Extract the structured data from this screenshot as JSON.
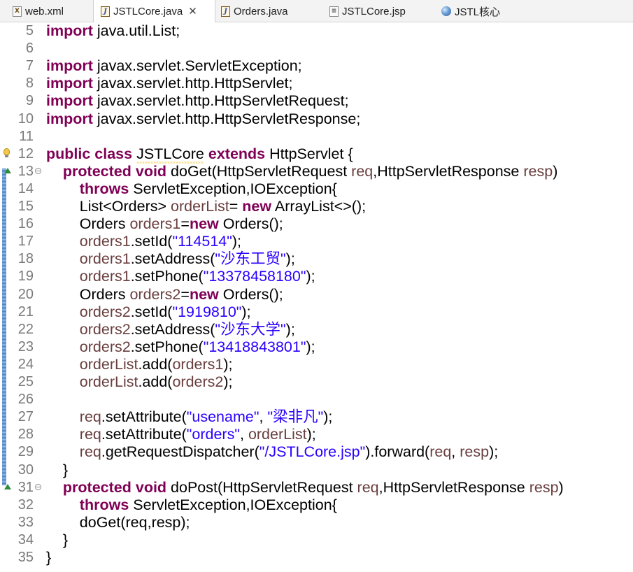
{
  "tabs": [
    {
      "label": "web.xml",
      "icon": "xml-file-icon",
      "icon_glyph": "X",
      "active": false
    },
    {
      "label": "JSTLCore.java",
      "icon": "java-file-icon",
      "icon_glyph": "J",
      "active": true,
      "close_glyph": "✕"
    },
    {
      "label": "Orders.java",
      "icon": "java-file-icon",
      "icon_glyph": "J",
      "active": false
    },
    {
      "label": "JSTLCore.jsp",
      "icon": "jsp-file-icon",
      "icon_glyph": "≡",
      "active": false
    },
    {
      "label": "JSTL核心",
      "icon": "browser-globe-icon",
      "active": false
    }
  ],
  "colors": {
    "keyword": "#7f0055",
    "variable": "#6a3e3e",
    "string": "#2a00ff",
    "line_number": "#7a7a7a",
    "change_marker": "#4f86c8"
  },
  "editor": {
    "lines": [
      {
        "n": "5",
        "tokens": [
          [
            "kw",
            "import"
          ],
          [
            "t",
            " java.util.List;"
          ]
        ]
      },
      {
        "n": "6",
        "tokens": []
      },
      {
        "n": "7",
        "tokens": [
          [
            "kw",
            "import"
          ],
          [
            "t",
            " javax.servlet.ServletException;"
          ]
        ]
      },
      {
        "n": "8",
        "tokens": [
          [
            "kw",
            "import"
          ],
          [
            "t",
            " javax.servlet.http.HttpServlet;"
          ]
        ]
      },
      {
        "n": "9",
        "tokens": [
          [
            "kw",
            "import"
          ],
          [
            "t",
            " javax.servlet.http.HttpServletRequest;"
          ]
        ]
      },
      {
        "n": "10",
        "tokens": [
          [
            "kw",
            "import"
          ],
          [
            "t",
            " javax.servlet.http.HttpServletResponse;"
          ]
        ]
      },
      {
        "n": "11",
        "tokens": []
      },
      {
        "n": "12",
        "marker": "warning",
        "tokens": [
          [
            "kw",
            "public"
          ],
          [
            "t",
            " "
          ],
          [
            "kw",
            "class"
          ],
          [
            "t",
            " "
          ],
          [
            "sq",
            "JSTLCore"
          ],
          [
            "t",
            " "
          ],
          [
            "kw",
            "extends"
          ],
          [
            "t",
            " HttpServlet {"
          ]
        ]
      },
      {
        "n": "13",
        "marker": "override",
        "fold": true,
        "tokens": [
          [
            "t",
            "    "
          ],
          [
            "kw",
            "protected"
          ],
          [
            "t",
            " "
          ],
          [
            "kw",
            "void"
          ],
          [
            "t",
            " doGet(HttpServletRequest "
          ],
          [
            "var",
            "req"
          ],
          [
            "t",
            ",HttpServletResponse "
          ],
          [
            "var",
            "resp"
          ],
          [
            "t",
            ")"
          ]
        ]
      },
      {
        "n": "14",
        "tokens": [
          [
            "t",
            "        "
          ],
          [
            "kw",
            "throws"
          ],
          [
            "t",
            " ServletException,IOException{"
          ]
        ]
      },
      {
        "n": "15",
        "tokens": [
          [
            "t",
            "        List<Orders> "
          ],
          [
            "var",
            "orderList"
          ],
          [
            "t",
            "= "
          ],
          [
            "kw",
            "new"
          ],
          [
            "t",
            " ArrayList<>();"
          ]
        ]
      },
      {
        "n": "16",
        "tokens": [
          [
            "t",
            "        Orders "
          ],
          [
            "var",
            "orders1"
          ],
          [
            "t",
            "="
          ],
          [
            "kw",
            "new"
          ],
          [
            "t",
            " Orders();"
          ]
        ]
      },
      {
        "n": "17",
        "tokens": [
          [
            "t",
            "        "
          ],
          [
            "var",
            "orders1"
          ],
          [
            "t",
            ".setId("
          ],
          [
            "str",
            "\"114514\""
          ],
          [
            "t",
            ");"
          ]
        ]
      },
      {
        "n": "18",
        "tokens": [
          [
            "t",
            "        "
          ],
          [
            "var",
            "orders1"
          ],
          [
            "t",
            ".setAddress("
          ],
          [
            "str",
            "\"沙东工贸\""
          ],
          [
            "t",
            ");"
          ]
        ]
      },
      {
        "n": "19",
        "tokens": [
          [
            "t",
            "        "
          ],
          [
            "var",
            "orders1"
          ],
          [
            "t",
            ".setPhone("
          ],
          [
            "str",
            "\"13378458180\""
          ],
          [
            "t",
            ");"
          ]
        ]
      },
      {
        "n": "20",
        "tokens": [
          [
            "t",
            "        Orders "
          ],
          [
            "var",
            "orders2"
          ],
          [
            "t",
            "="
          ],
          [
            "kw",
            "new"
          ],
          [
            "t",
            " Orders();"
          ]
        ]
      },
      {
        "n": "21",
        "tokens": [
          [
            "t",
            "        "
          ],
          [
            "var",
            "orders2"
          ],
          [
            "t",
            ".setId("
          ],
          [
            "str",
            "\"1919810\""
          ],
          [
            "t",
            ");"
          ]
        ]
      },
      {
        "n": "22",
        "tokens": [
          [
            "t",
            "        "
          ],
          [
            "var",
            "orders2"
          ],
          [
            "t",
            ".setAddress("
          ],
          [
            "str",
            "\"沙东大学\""
          ],
          [
            "t",
            ");"
          ]
        ]
      },
      {
        "n": "23",
        "tokens": [
          [
            "t",
            "        "
          ],
          [
            "var",
            "orders2"
          ],
          [
            "t",
            ".setPhone("
          ],
          [
            "str",
            "\"13418843801\""
          ],
          [
            "t",
            ");"
          ]
        ]
      },
      {
        "n": "24",
        "tokens": [
          [
            "t",
            "        "
          ],
          [
            "var",
            "orderList"
          ],
          [
            "t",
            ".add("
          ],
          [
            "var",
            "orders1"
          ],
          [
            "t",
            ");"
          ]
        ]
      },
      {
        "n": "25",
        "tokens": [
          [
            "t",
            "        "
          ],
          [
            "var",
            "orderList"
          ],
          [
            "t",
            ".add("
          ],
          [
            "var",
            "orders2"
          ],
          [
            "t",
            ");"
          ]
        ]
      },
      {
        "n": "26",
        "tokens": []
      },
      {
        "n": "27",
        "tokens": [
          [
            "t",
            "        "
          ],
          [
            "var",
            "req"
          ],
          [
            "t",
            ".setAttribute("
          ],
          [
            "str",
            "\"usename\""
          ],
          [
            "t",
            ", "
          ],
          [
            "str",
            "\"梁非凡\""
          ],
          [
            "t",
            ");"
          ]
        ]
      },
      {
        "n": "28",
        "tokens": [
          [
            "t",
            "        "
          ],
          [
            "var",
            "req"
          ],
          [
            "t",
            ".setAttribute("
          ],
          [
            "str",
            "\"orders\""
          ],
          [
            "t",
            ", "
          ],
          [
            "var",
            "orderList"
          ],
          [
            "t",
            ");"
          ]
        ]
      },
      {
        "n": "29",
        "tokens": [
          [
            "t",
            "        "
          ],
          [
            "var",
            "req"
          ],
          [
            "t",
            ".getRequestDispatcher("
          ],
          [
            "str",
            "\"/JSTLCore.jsp\""
          ],
          [
            "t",
            ").forward("
          ],
          [
            "var",
            "req"
          ],
          [
            "t",
            ", "
          ],
          [
            "var",
            "resp"
          ],
          [
            "t",
            ");"
          ]
        ]
      },
      {
        "n": "30",
        "tokens": [
          [
            "t",
            "    }"
          ]
        ]
      },
      {
        "n": "31",
        "marker": "override",
        "fold": true,
        "tokens": [
          [
            "t",
            "    "
          ],
          [
            "kw",
            "protected"
          ],
          [
            "t",
            " "
          ],
          [
            "kw",
            "void"
          ],
          [
            "t",
            " doPost(HttpServletRequest "
          ],
          [
            "var",
            "req"
          ],
          [
            "t",
            ",HttpServletResponse "
          ],
          [
            "var",
            "resp"
          ],
          [
            "t",
            ")"
          ]
        ]
      },
      {
        "n": "32",
        "tokens": [
          [
            "t",
            "        "
          ],
          [
            "kw",
            "throws"
          ],
          [
            "t",
            " ServletException,IOException{"
          ]
        ]
      },
      {
        "n": "33",
        "tokens": [
          [
            "t",
            "        doGet(req,resp);"
          ]
        ]
      },
      {
        "n": "34",
        "tokens": [
          [
            "t",
            "    }"
          ]
        ]
      },
      {
        "n": "35",
        "tokens": [
          [
            "t",
            "}"
          ]
        ]
      }
    ]
  }
}
